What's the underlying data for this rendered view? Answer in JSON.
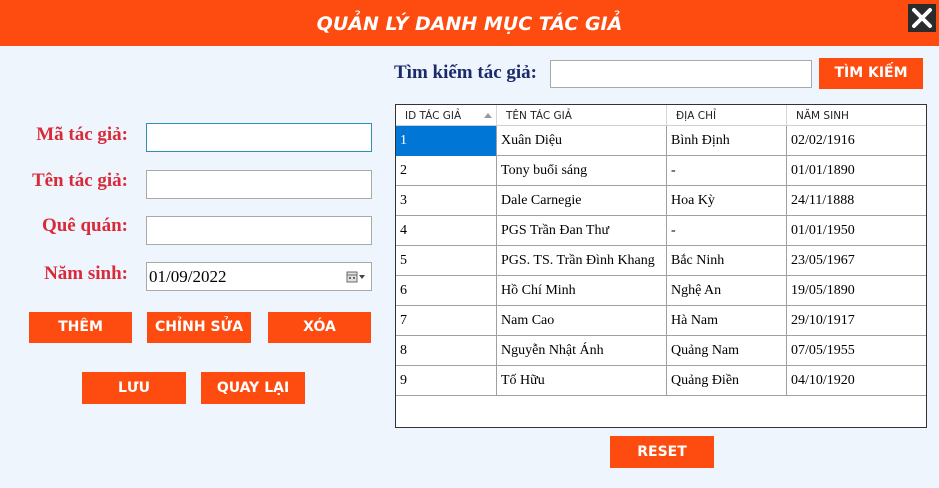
{
  "window": {
    "title": "QUẢN LÝ DANH MỤC TÁC GIẢ"
  },
  "form": {
    "ma_label": "Mã tác giả:",
    "ten_label": "Tên tác giả:",
    "que_label": "Quê quán:",
    "nam_label": "Năm sinh:",
    "ma_value": "",
    "ten_value": "",
    "que_value": "",
    "nam_value": "01/09/2022"
  },
  "buttons": {
    "them": "THÊM",
    "chinh_sua": "CHỈNH SỬA",
    "xoa": "XÓA",
    "luu": "LƯU",
    "quay_lai": "QUAY LẠI",
    "reset": "RESET"
  },
  "search": {
    "label": "Tìm kiếm tác giả:",
    "value": "",
    "button": "TÌM KIẾM"
  },
  "table": {
    "headers": [
      "ID TÁC GIẢ",
      "TÊN TÁC GIẢ",
      "ĐỊA CHỈ",
      "NĂM SINH"
    ],
    "rows": [
      [
        "1",
        "Xuân Diệu",
        "Bình Định",
        "02/02/1916"
      ],
      [
        "2",
        "Tony buổi sáng",
        "-",
        "01/01/1890"
      ],
      [
        "3",
        "Dale Carnegie",
        "Hoa Kỳ",
        "24/11/1888"
      ],
      [
        "4",
        "PGS Trần Đan Thư",
        "-",
        "01/01/1950"
      ],
      [
        "5",
        "PGS. TS. Trần Đình Khang",
        "Bắc Ninh",
        "23/05/1967"
      ],
      [
        "6",
        "Hồ Chí Minh",
        "Nghệ An",
        "19/05/1890"
      ],
      [
        "7",
        "Nam Cao",
        "Hà Nam",
        "29/10/1917"
      ],
      [
        "8",
        "Nguyễn Nhật Ánh",
        "Quảng Nam",
        "07/05/1955"
      ],
      [
        "9",
        "Tố Hữu",
        "Quảng Điền",
        "04/10/1920"
      ]
    ],
    "selected_row": 0
  },
  "colors": {
    "accent": "#fe4b0f",
    "label": "#d92a3a",
    "search_label": "#1b2a6b",
    "selection": "#0077d7"
  }
}
